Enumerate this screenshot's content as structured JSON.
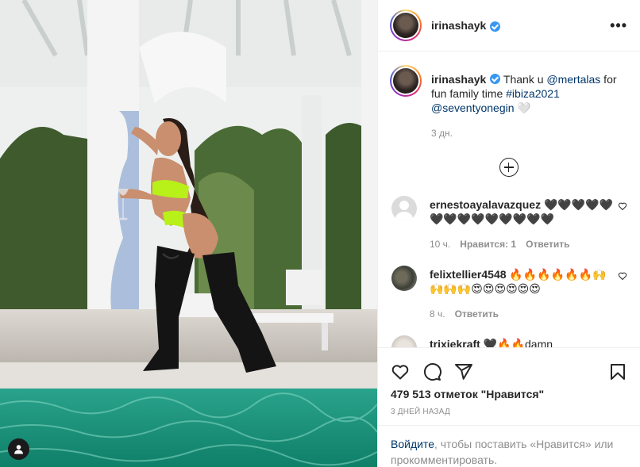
{
  "post": {
    "username": "irinashayk",
    "verified": true,
    "more_label": "•••"
  },
  "caption": {
    "username": "irinashayk",
    "text_1": "Thank u ",
    "mention_1": "@mertalas",
    "text_2": " for fun family time ",
    "hashtag": "#ibiza2021",
    "mention_2": "@seventyonegin",
    "emoji": "🤍",
    "time": "3 дн."
  },
  "comments": [
    {
      "username": "ernestoayalavazquez",
      "text": "🖤🖤🖤🖤🖤🖤🖤🖤🖤🖤🖤🖤🖤🖤",
      "time": "10 ч.",
      "likes": "Нравится: 1",
      "reply": "Ответить"
    },
    {
      "username": "felixtellier4548",
      "text": "🔥🔥🔥🔥🔥🔥🙌🙌🙌🙌😍😍😍😍😍😍",
      "time": "8 ч.",
      "reply": "Ответить"
    },
    {
      "username": "trixiekraft",
      "text": "🖤🔥🔥damn"
    }
  ],
  "actions": {
    "likes": "479 513 отметок \"Нравится\"",
    "date": "3 ДНЕЙ НАЗАД"
  },
  "login_prompt": {
    "link": "Войдите",
    "text": ", чтобы поставить «Нравится» или прокомментировать."
  },
  "colors": {
    "link": "#00376b",
    "verified": "#3897f0",
    "muted": "#8e8e8e",
    "pool": "#1f9e86",
    "bikini": "#b8f01a"
  },
  "icons": {
    "more": "more-icon",
    "verified": "verified-badge-icon",
    "load_more": "plus-circle-icon",
    "like": "heart-icon",
    "comment": "comment-icon",
    "share": "share-icon",
    "save": "bookmark-icon",
    "user_tag": "user-tag-icon"
  }
}
